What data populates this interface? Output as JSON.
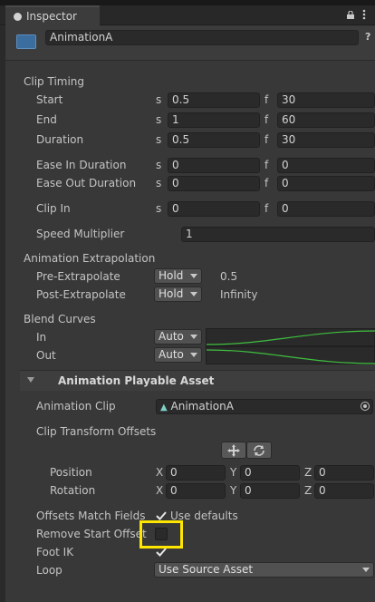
{
  "window": {
    "tab_title": "Inspector",
    "asset_name": "AnimationA"
  },
  "clip_timing": {
    "header": "Clip Timing",
    "rows": [
      {
        "label": "Start",
        "s_unit": "s",
        "s": "0.5",
        "f_unit": "f",
        "f": "30"
      },
      {
        "label": "End",
        "s_unit": "s",
        "s": "1",
        "f_unit": "f",
        "f": "60"
      },
      {
        "label": "Duration",
        "s_unit": "s",
        "s": "0.5",
        "f_unit": "f",
        "f": "30"
      },
      {
        "label": "Ease In Duration",
        "s_unit": "s",
        "s": "0",
        "f_unit": "f",
        "f": "0"
      },
      {
        "label": "Ease Out Duration",
        "s_unit": "s",
        "s": "0",
        "f_unit": "f",
        "f": "0"
      },
      {
        "label": "Clip In",
        "s_unit": "s",
        "s": "0",
        "f_unit": "f",
        "f": "0"
      }
    ],
    "speed_label": "Speed Multiplier",
    "speed_value": "1"
  },
  "extrapolation": {
    "header": "Animation Extrapolation",
    "pre_label": "Pre-Extrapolate",
    "pre_value": "Hold",
    "pre_extra": "0.5",
    "post_label": "Post-Extrapolate",
    "post_value": "Hold",
    "post_extra": "Infinity"
  },
  "blend_curves": {
    "header": "Blend Curves",
    "in_label": "In",
    "in_value": "Auto",
    "out_label": "Out",
    "out_value": "Auto"
  },
  "playable": {
    "header": "Animation Playable Asset",
    "clip_label": "Animation Clip",
    "clip_value": "AnimationA",
    "offsets_label": "Clip Transform Offsets",
    "position_label": "Position",
    "rotation_label": "Rotation",
    "axes": [
      "X",
      "Y",
      "Z"
    ],
    "position": [
      "0",
      "0",
      "0"
    ],
    "rotation": [
      "0",
      "0",
      "0"
    ],
    "offsets_match_label": "Offsets Match Fields",
    "use_defaults_label": "Use defaults",
    "remove_start_label": "Remove Start Offset",
    "foot_ik_label": "Foot IK",
    "loop_label": "Loop",
    "loop_value": "Use Source Asset"
  },
  "colors": {
    "highlight": "#ffe600",
    "curve": "#3fbf3f"
  }
}
